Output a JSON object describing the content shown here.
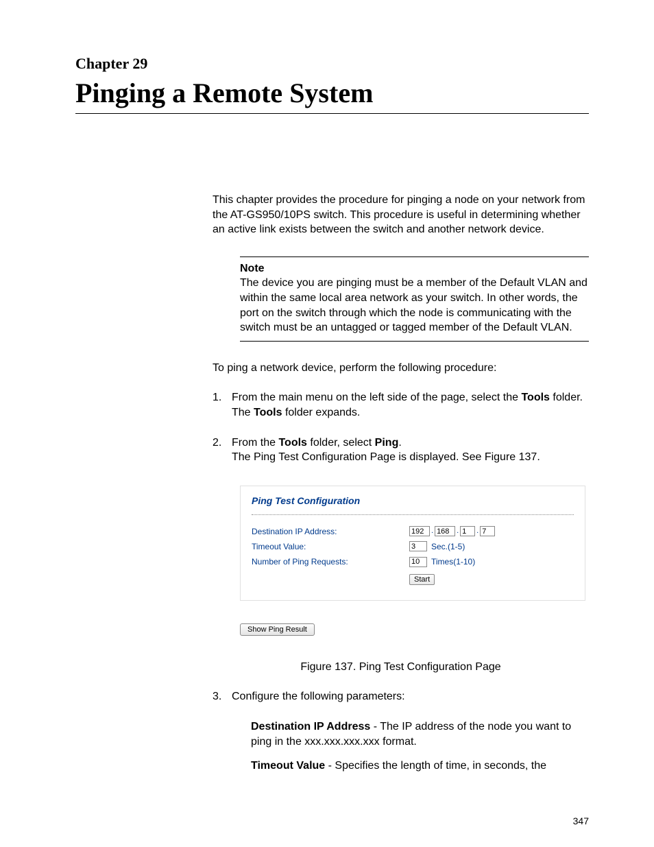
{
  "header": {
    "chapter_label": "Chapter 29",
    "chapter_title": "Pinging a Remote System"
  },
  "intro": "This chapter provides the procedure for pinging a node on your network from the AT-GS950/10PS switch. This procedure is useful in determining whether an active link exists between the switch and another network device.",
  "note": {
    "label": "Note",
    "body": "The device you are pinging must be a member of the Default VLAN and within the same local area network as your switch. In other words, the port on the switch through which the node is communicating with the switch must be an untagged or tagged member of the Default VLAN."
  },
  "procedure_intro": "To ping a network device, perform the following procedure:",
  "steps": {
    "s1": {
      "num": "1.",
      "line1a": "From the main menu on the left side of the page, select the ",
      "line1b": "Tools",
      "line1c": " folder.",
      "line2a": "The ",
      "line2b": "Tools",
      "line2c": " folder expands."
    },
    "s2": {
      "num": "2.",
      "line1a": "From the ",
      "line1b": "Tools",
      "line1c": " folder, select ",
      "line1d": "Ping",
      "line1e": ".",
      "line2": "The Ping Test Configuration Page is displayed. See Figure 137."
    },
    "s3": {
      "num": "3.",
      "line1": "Configure the following parameters:"
    }
  },
  "figure": {
    "title": "Ping Test Configuration",
    "labels": {
      "dest": "Destination IP Address:",
      "timeout": "Timeout Value:",
      "count": "Number of Ping Requests:"
    },
    "ip": {
      "o1": "192",
      "o2": "168",
      "o3": "1",
      "o4": "7"
    },
    "timeout_val": "3",
    "timeout_unit": "Sec.(1-5)",
    "count_val": "10",
    "count_unit": "Times(1-10)",
    "start_btn": "Start",
    "show_btn": "Show Ping Result",
    "caption": "Figure 137. Ping Test Configuration Page"
  },
  "params": {
    "p1": {
      "name": "Destination IP Address",
      "desc": " - The IP address of the node you want to ping in the xxx.xxx.xxx.xxx format."
    },
    "p2": {
      "name": "Timeout Value",
      "desc": " - Specifies the length of time, in seconds, the"
    }
  },
  "page_number": "347"
}
